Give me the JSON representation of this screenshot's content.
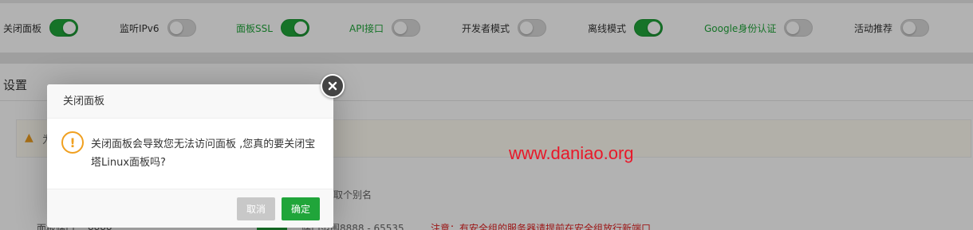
{
  "toggles": [
    {
      "label": "关闭面板",
      "state": "on",
      "label_color": "default"
    },
    {
      "label": "监听IPv6",
      "state": "off",
      "label_color": "default"
    },
    {
      "label": "面板SSL",
      "state": "on",
      "label_color": "green"
    },
    {
      "label": "API接口",
      "state": "off",
      "label_color": "green"
    },
    {
      "label": "开发者模式",
      "state": "off",
      "label_color": "default"
    },
    {
      "label": "离线模式",
      "state": "on",
      "label_color": "default"
    },
    {
      "label": "Google身份认证",
      "state": "off",
      "label_color": "green"
    },
    {
      "label": "活动推荐",
      "state": "off",
      "label_color": "default"
    }
  ],
  "settings": {
    "title": "设置",
    "warning_prefix": "为",
    "alias_hint": "取个别名",
    "port": {
      "label": "面板端口",
      "value": "8888",
      "range_text": "端口范围8888 - 65535",
      "note": "注意：有安全组的服务器请提前在安全组放行新端口"
    }
  },
  "dialog": {
    "title": "关闭面板",
    "message": "关闭面板会导致您无法访问面板 ,您真的要关闭宝塔Linux面板吗?",
    "cancel_label": "取消",
    "confirm_label": "确定"
  },
  "watermark": "www.daniao.org",
  "colors": {
    "accent_green": "#20a53a",
    "warning_orange": "#f0a020",
    "note_red": "#e02020",
    "watermark_red": "#e8182a"
  }
}
